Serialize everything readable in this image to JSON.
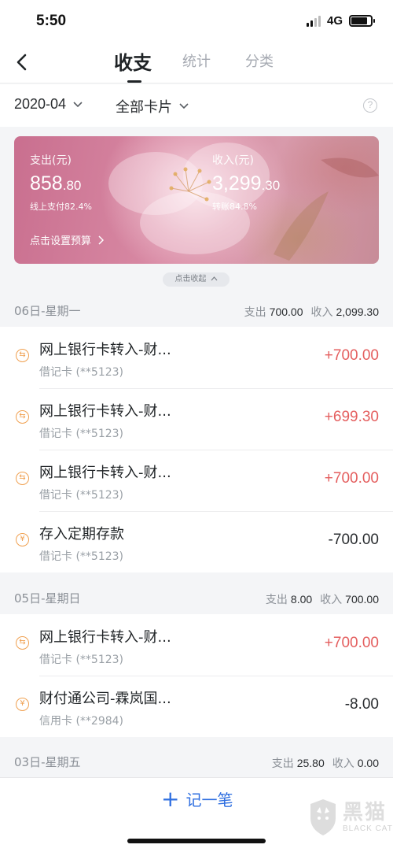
{
  "status_bar": {
    "time": "5:50",
    "network": "4G"
  },
  "nav": {
    "tabs": [
      {
        "label": "收支"
      },
      {
        "label": "统计"
      },
      {
        "label": "分类"
      }
    ]
  },
  "filters": {
    "month": "2020-04",
    "card": "全部卡片",
    "help": "?"
  },
  "summary": {
    "expense_label": "支出(元)",
    "expense_int": "858",
    "expense_dec": ".80",
    "expense_note": "线上支付82.4%",
    "income_label": "收入(元)",
    "income_int": "3,299",
    "income_dec": ".30",
    "income_note": "转账84.8%",
    "budget_link": "点击设置预算",
    "collapse": "点击收起"
  },
  "days": [
    {
      "title": "06日-星期一",
      "expense_label": "支出",
      "expense": "700.00",
      "income_label": "收入",
      "income": "2,099.30",
      "transactions": [
        {
          "title": "网上银行卡转入-财...",
          "account": "借记卡 (**5123)",
          "amount": "+700.00",
          "icon": "transfer-icon"
        },
        {
          "title": "网上银行卡转入-财...",
          "account": "借记卡 (**5123)",
          "amount": "+699.30",
          "icon": "transfer-icon"
        },
        {
          "title": "网上银行卡转入-财...",
          "account": "借记卡 (**5123)",
          "amount": "+700.00",
          "icon": "transfer-icon"
        },
        {
          "title": "存入定期存款",
          "account": "借记卡 (**5123)",
          "amount": "-700.00",
          "icon": "yuan-icon"
        }
      ]
    },
    {
      "title": "05日-星期日",
      "expense_label": "支出",
      "expense": "8.00",
      "income_label": "收入",
      "income": "700.00",
      "transactions": [
        {
          "title": "网上银行卡转入-财...",
          "account": "借记卡 (**5123)",
          "amount": "+700.00",
          "icon": "transfer-icon"
        },
        {
          "title": "财付通公司-霖岚国...",
          "account": "信用卡 (**2984)",
          "amount": "-8.00",
          "icon": "yuan-icon"
        }
      ]
    },
    {
      "title": "03日-星期五",
      "expense_label": "支出",
      "expense": "25.80",
      "income_label": "收入",
      "income": "0.00",
      "transactions": []
    }
  ],
  "bottom": {
    "add_label": "记一笔",
    "add_icon": "+"
  },
  "watermark": {
    "text": "黑猫",
    "sub": "BLACK CAT"
  },
  "colors": {
    "accent_blue": "#2f6fe0",
    "income_red": "#e45e5e",
    "icon_orange": "#f0a050"
  }
}
